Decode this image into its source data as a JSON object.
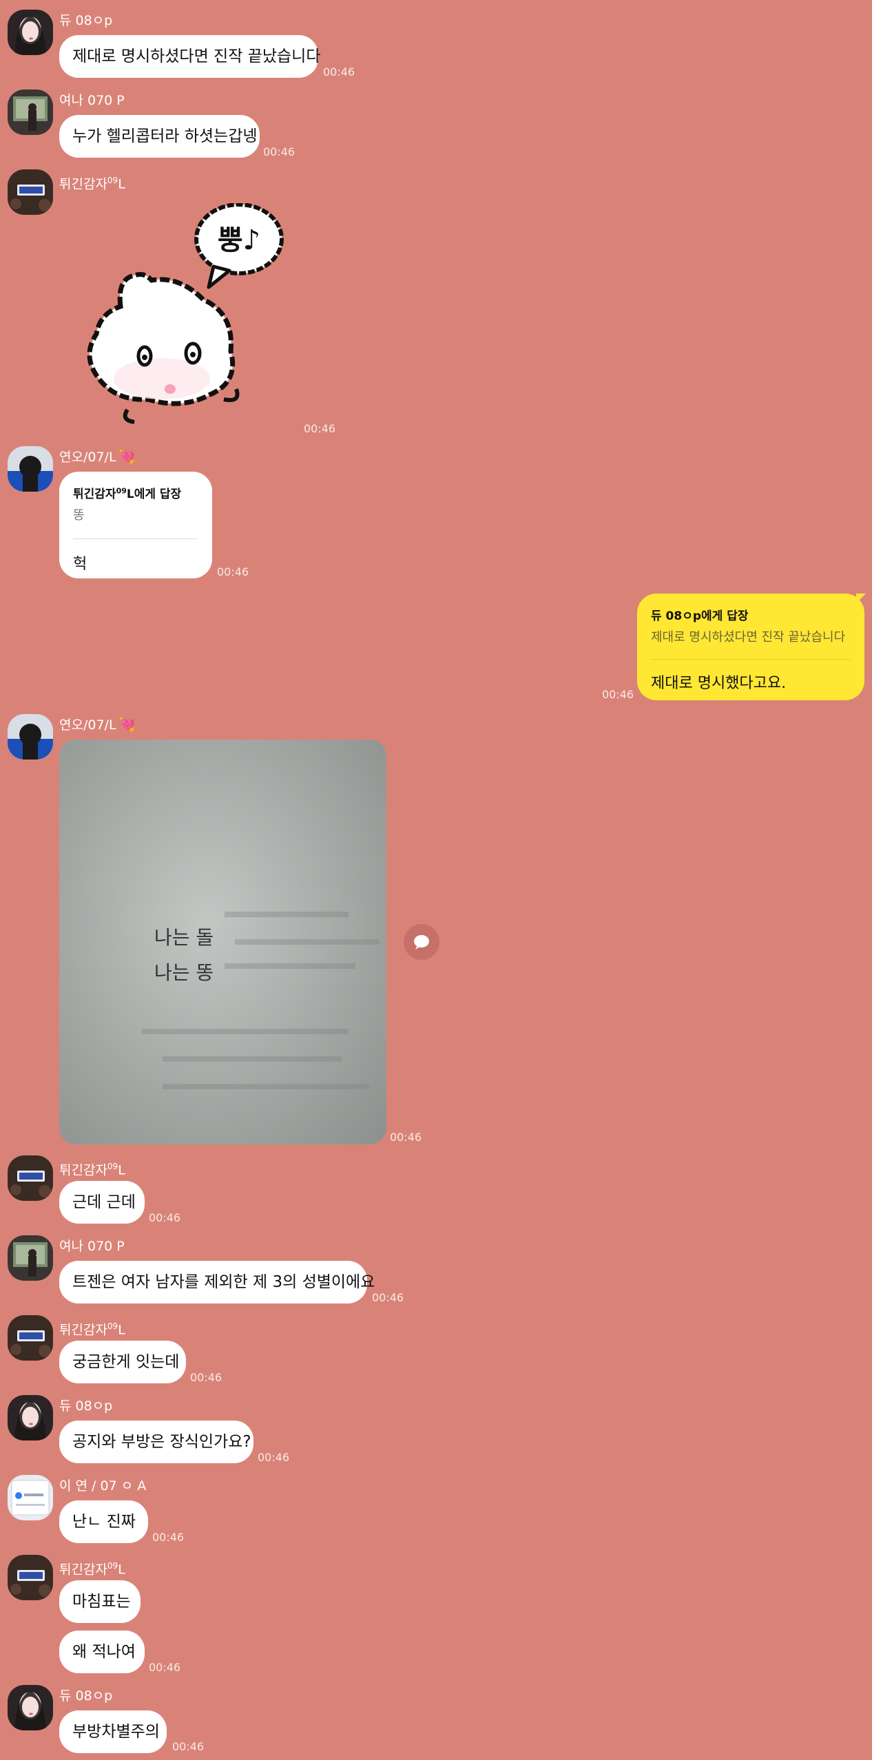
{
  "messages": [
    {
      "sender": "듀 08ㅇp",
      "text": "제대로 명시하셨다면 진작 끝났습니다",
      "time": "00:46"
    },
    {
      "sender": "여나 070 P",
      "text": "누가 헬리콥터라 하셧는갑넹",
      "time": "00:46"
    },
    {
      "sender_main": "튀긴감자",
      "sender_sup": "09",
      "sender_end": "L",
      "sticker_text": "뿡♪",
      "time": "00:46"
    },
    {
      "sender": "연오/07/L",
      "heart": "💘",
      "reply_title_main": "튀긴감자",
      "reply_title_sup": "09",
      "reply_title_end": "L에게 답장",
      "reply_quote": "똥",
      "text": "헉",
      "time": "00:46"
    },
    {
      "reply_title": "듀 08ㅇp에게 답장",
      "reply_quote": "제대로 명시하셨다면 진작 끝났습니다",
      "text": "제대로 명시했다고요.",
      "time": "00:46"
    },
    {
      "sender": "연오/07/L",
      "heart": "💘",
      "photo_line1": "나는 돌",
      "photo_line2": "나는 똥",
      "time": "00:46"
    },
    {
      "sender_main": "튀긴감자",
      "sender_sup": "09",
      "sender_end": "L",
      "text": "근데 근데",
      "time": "00:46"
    },
    {
      "sender": "여나 070 P",
      "text": "트젠은 여자 남자를 제외한 제 3의 성별이에요",
      "time": "00:46"
    },
    {
      "sender_main": "튀긴감자",
      "sender_sup": "09",
      "sender_end": "L",
      "text": "궁금한게 잇는데",
      "time": "00:46"
    },
    {
      "sender": "듀 08ㅇp",
      "text": "공지와 부방은 장식인가요?",
      "time": "00:46"
    },
    {
      "sender": "이 연 / 07 ㅇ A",
      "text": "난ㄴ 진짜",
      "time": "00:46"
    },
    {
      "sender_main": "튀긴감자",
      "sender_sup": "09",
      "sender_end": "L",
      "text": "마침표는",
      "text2": "왜 적나여",
      "time": "00:46"
    },
    {
      "sender": "듀 08ㅇp",
      "text": "부방차별주의",
      "time": "00:46"
    }
  ],
  "colors": {
    "background": "#d98378",
    "my_bubble": "#ffe733",
    "other_bubble": "#ffffff"
  },
  "icons": [
    "speech-bubble-icon"
  ]
}
